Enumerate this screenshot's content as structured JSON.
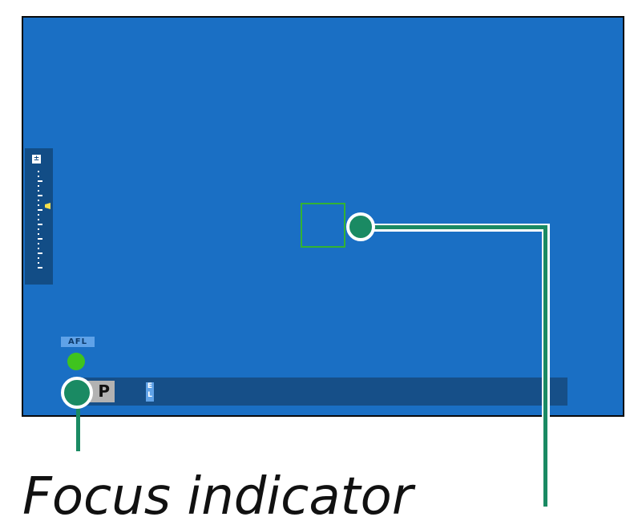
{
  "viewfinder": {
    "exposure_icon": "exposure-compensation-icon",
    "afl_label": "AFL",
    "shooting_mode": "P",
    "el_label": "EL",
    "colors": {
      "screen": "#1a6fc4",
      "info_bar": "#164f88",
      "focus_indicator": "#3fc31e",
      "af_frame": "#33b233",
      "callout": "#1a8a63"
    }
  },
  "caption": "Focus indicator"
}
